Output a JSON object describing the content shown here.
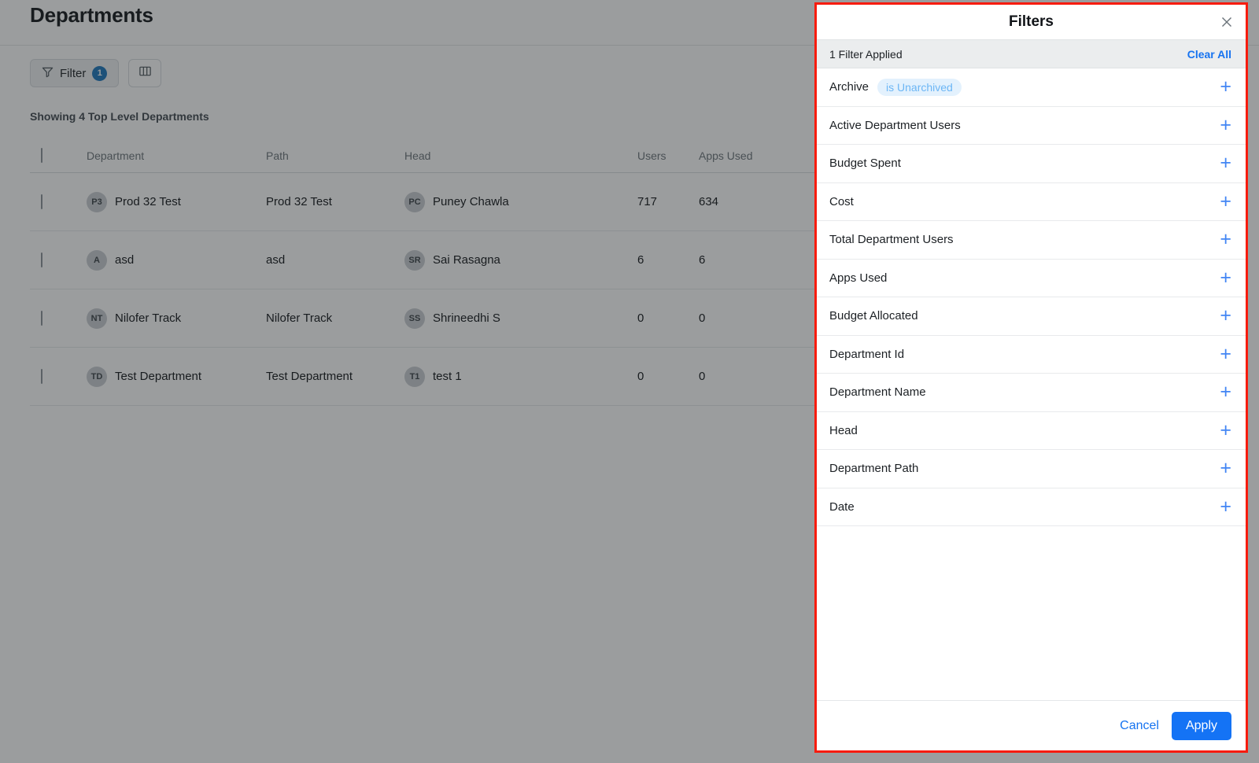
{
  "page": {
    "title": "Departments",
    "toolbar": {
      "filter_label": "Filter",
      "filter_count": "1",
      "filter_icon": "funnel-icon",
      "columns_icon": "columns-icon"
    },
    "showing_text": "Showing 4 Top Level Departments",
    "table": {
      "columns": [
        "Department",
        "Path",
        "Head",
        "Users",
        "Apps Used"
      ],
      "rows": [
        {
          "dept_initials": "P3",
          "dept": "Prod 32 Test",
          "path": "Prod 32 Test",
          "head_initials": "PC",
          "head": "Puney Chawla",
          "users": "717",
          "apps": "634"
        },
        {
          "dept_initials": "A",
          "dept": "asd",
          "path": "asd",
          "head_initials": "SR",
          "head": "Sai Rasagna",
          "users": "6",
          "apps": "6"
        },
        {
          "dept_initials": "NT",
          "dept": "Nilofer Track",
          "path": "Nilofer Track",
          "head_initials": "SS",
          "head": "Shrineedhi S",
          "users": "0",
          "apps": "0"
        },
        {
          "dept_initials": "TD",
          "dept": "Test Department",
          "path": "Test Department",
          "head_initials": "T1",
          "head": "test 1",
          "users": "0",
          "apps": "0"
        }
      ]
    }
  },
  "filters_panel": {
    "title": "Filters",
    "close_icon": "close-icon",
    "applied_text": "1 Filter Applied",
    "clear_all_label": "Clear All",
    "items": [
      {
        "label": "Archive",
        "chip": "is Unarchived"
      },
      {
        "label": "Active Department Users",
        "chip": ""
      },
      {
        "label": "Budget Spent",
        "chip": ""
      },
      {
        "label": "Cost",
        "chip": ""
      },
      {
        "label": "Total Department Users",
        "chip": ""
      },
      {
        "label": "Apps Used",
        "chip": ""
      },
      {
        "label": "Budget Allocated",
        "chip": ""
      },
      {
        "label": "Department Id",
        "chip": ""
      },
      {
        "label": "Department Name",
        "chip": ""
      },
      {
        "label": "Head",
        "chip": ""
      },
      {
        "label": "Department Path",
        "chip": ""
      },
      {
        "label": "Date",
        "chip": ""
      }
    ],
    "add_icon": "plus-icon",
    "cancel_label": "Cancel",
    "apply_label": "Apply"
  },
  "colors": {
    "accent_blue": "#1473f5",
    "link_blue": "#1673f0",
    "chip_bg": "#e3f1fd",
    "chip_text": "#6cb6f5",
    "highlight_border": "#f71b0d",
    "badge_blue": "#1b76bc"
  }
}
